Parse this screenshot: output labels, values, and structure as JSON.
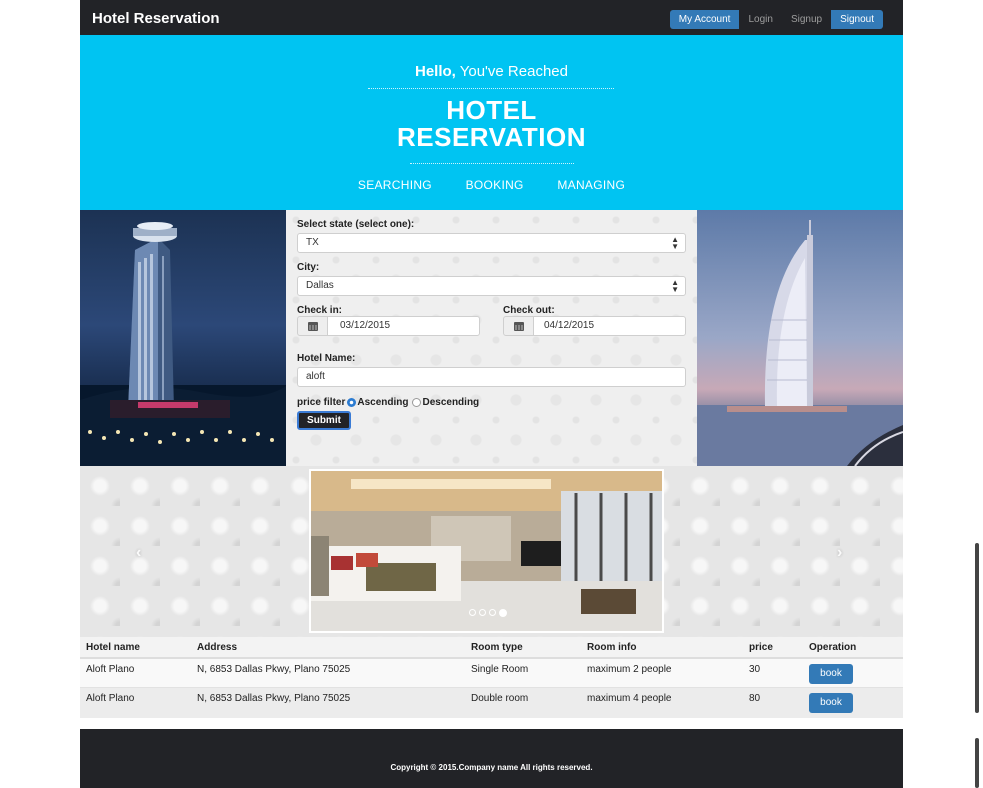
{
  "navbar": {
    "brand": "Hotel Reservation",
    "links": [
      "My Account",
      "Login",
      "Signup",
      "Signout"
    ]
  },
  "hero": {
    "hello_bold": "Hello,",
    "hello_rest": " You've Reached",
    "title_line1": "HOTEL",
    "title_line2": "RESERVATION",
    "tabs": [
      "SEARCHING",
      "BOOKING",
      "MANAGING"
    ]
  },
  "form": {
    "state_label": "Select state (select one):",
    "state_value": "TX",
    "city_label": "City:",
    "city_value": "Dallas",
    "checkin_label": "Check in:",
    "checkin_value": "03/12/2015",
    "checkout_label": "Check out:",
    "checkout_value": "04/12/2015",
    "hotel_name_label": "Hotel Name:",
    "hotel_name_value": "aloft",
    "price_filter_label": "price filter",
    "ascending_label": "Ascending",
    "descending_label": "Descending",
    "submit_label": "Submit"
  },
  "carousel": {
    "prev_glyph": "‹",
    "next_glyph": "›",
    "slide_count": 4,
    "active_index": 3
  },
  "table": {
    "headers": [
      "Hotel name",
      "Address",
      "Room type",
      "Room info",
      "price",
      "Operation"
    ],
    "rows": [
      {
        "hotel": "Aloft Plano",
        "address": "N, 6853 Dallas Pkwy, Plano 75025",
        "room_type": "Single Room",
        "room_info": "maximum 2 people",
        "price": "30",
        "action": "book"
      },
      {
        "hotel": "Aloft Plano",
        "address": "N, 6853 Dallas Pkwy, Plano 75025",
        "room_type": "Double room",
        "room_info": "maximum 4 people",
        "price": "80",
        "action": "book"
      }
    ]
  },
  "footer": {
    "copyright": "Copyright © 2015.Company name All rights reserved."
  },
  "colors": {
    "hero_bg": "#00c4f2",
    "navbar_bg": "#222327",
    "primary": "#337ab7"
  }
}
